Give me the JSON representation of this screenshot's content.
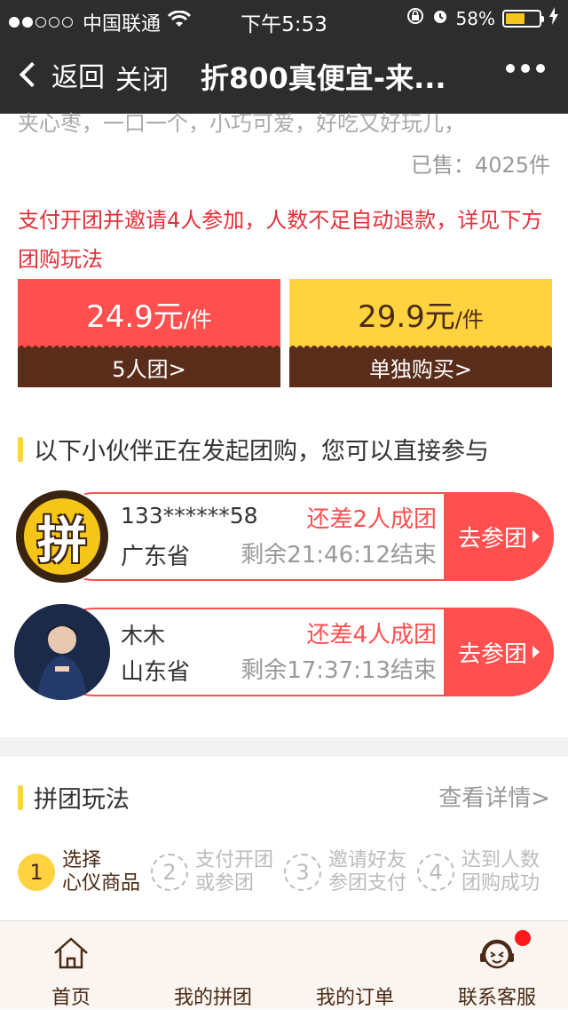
{
  "status": {
    "carrier": "中国联通",
    "time": "下午5:53",
    "battery": "58%",
    "battery_level": 0.58
  },
  "nav": {
    "back_label": "返回",
    "close_label": "关闭",
    "title": "折800真便宜-来..."
  },
  "product": {
    "desc_cut": "夹心枣，一口一个，小巧可爱，好吃又好玩儿，",
    "sold": "已售：4025件"
  },
  "notice": "支付开团并邀请4人参加，人数不足自动退款，详见下方团购玩法",
  "buy": {
    "group": {
      "price": "24.9元",
      "unit": "/件",
      "label": "5人团>"
    },
    "solo": {
      "price": "29.9元",
      "unit": "/件",
      "label": "单独购买>"
    }
  },
  "teams_section": {
    "title": "以下小伙伴正在发起团购，您可以直接参与",
    "teams": [
      {
        "name": "133******58",
        "province": "广东省",
        "need": "还差2人成团",
        "remain": "剩余21:46:12结束",
        "join": "去参团"
      },
      {
        "name": "木木",
        "province": "山东省",
        "need": "还差4人成团",
        "remain": "剩余17:37:13结束",
        "join": "去参团"
      }
    ],
    "logo_char": "拼"
  },
  "rules_section": {
    "title": "拼团玩法",
    "detail": "查看详情>",
    "steps": [
      {
        "num": "1",
        "line1": "选择",
        "line2": "心仪商品"
      },
      {
        "num": "2",
        "line1": "支付开团",
        "line2": "或参团"
      },
      {
        "num": "3",
        "line1": "邀请好友",
        "line2": "参团支付"
      },
      {
        "num": "4",
        "line1": "达到人数",
        "line2": "团购成功"
      }
    ]
  },
  "tabs": [
    {
      "label": "首页",
      "icon": "home-icon"
    },
    {
      "label": "我的拼团",
      "icon": ""
    },
    {
      "label": "我的订单",
      "icon": ""
    },
    {
      "label": "联系客服",
      "icon": "customer-service-icon"
    }
  ],
  "colors": {
    "accent_red": "#ff4f4f",
    "accent_yellow": "#ffd23f",
    "brown": "#5a2d1a",
    "nav_bg": "#2d2d2d"
  }
}
